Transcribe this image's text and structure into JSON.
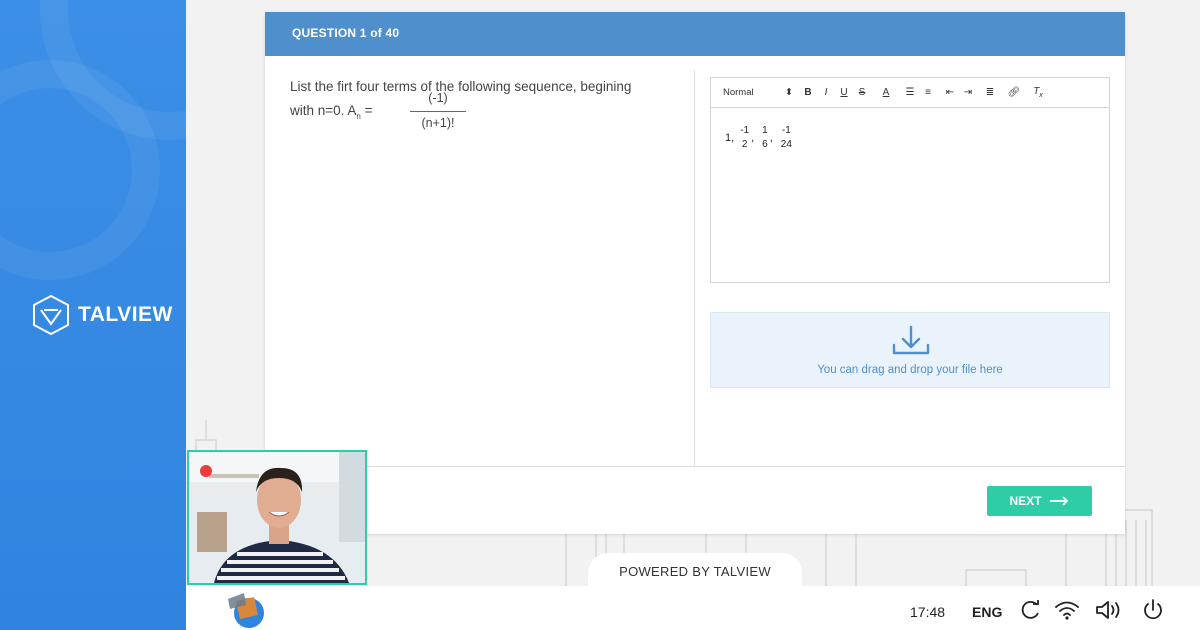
{
  "sidebar": {
    "brand": "TALVIEW"
  },
  "question": {
    "header": "QUESTION 1 of 40",
    "text": "List the firt four terms of the following sequence, begining",
    "formula_prefix": "with n=0. A",
    "formula_subscript": "n",
    "formula_equals": "=",
    "numerator": "(-1)",
    "denominator": "(n+1)!"
  },
  "editor": {
    "format_select": "Normal",
    "toolbar_icons": [
      "bold-icon",
      "italic-icon",
      "underline-icon",
      "strike-icon",
      "text-color-icon",
      "ordered-list-icon",
      "bullet-list-icon",
      "outdent-icon",
      "indent-icon",
      "align-icon",
      "link-icon",
      "clear-format-icon"
    ],
    "answer": {
      "first": "1,",
      "terms": [
        {
          "num": "-1",
          "den": "2",
          "sep": ","
        },
        {
          "num": "1",
          "den": "6",
          "sep": ","
        },
        {
          "num": "-1",
          "den": "24",
          "sep": ""
        }
      ]
    }
  },
  "upload": {
    "text": "You can drag and drop your file here"
  },
  "actions": {
    "next_label": "NEXT"
  },
  "footer": {
    "powered": "POWERED BY TALVIEW"
  },
  "taskbar": {
    "time": "17:48",
    "language": "ENG"
  },
  "colors": {
    "sidebar": "#3c8fe6",
    "header": "#4f90cc",
    "accent": "#2fcca8",
    "record": "#ec3b3b"
  }
}
